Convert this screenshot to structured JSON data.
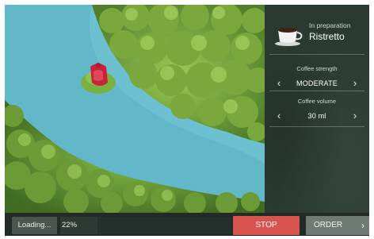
{
  "status": {
    "state_label": "In preparation",
    "product": "Ristretto"
  },
  "settings": [
    {
      "label": "Coffee strength",
      "value": "MODERATE"
    },
    {
      "label": "Coffee volume",
      "value": "30 ml"
    }
  ],
  "icons": {
    "cup": "coffee-cup-icon",
    "prev": "chevron-left-icon",
    "next": "chevron-right-icon"
  },
  "progress": {
    "button_label": "Loading...",
    "percent_label": "22%",
    "fraction": 0.22
  },
  "actions": {
    "stop_label": "STOP",
    "order_label": "ORDER"
  },
  "colors": {
    "stop": "#d9534f",
    "order": "#6e7a73",
    "panel": "#2a3a31",
    "water": "#5fb7c6",
    "trees": "#6f9a3a"
  }
}
